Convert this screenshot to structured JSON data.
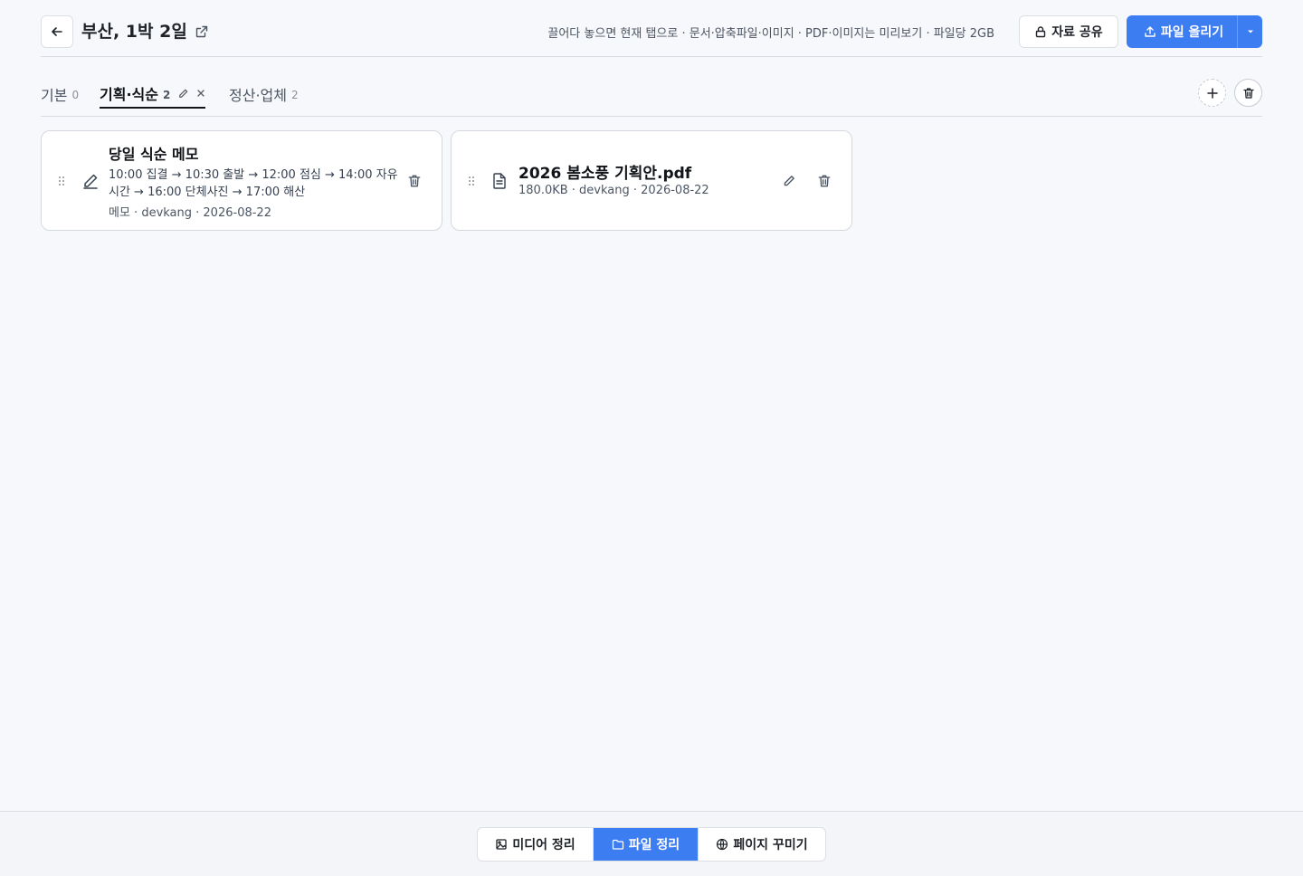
{
  "header": {
    "title": "부산, 1박 2일",
    "hint": "끌어다 놓으면 현재 탭으로 · 문서·압축파일·이미지 · PDF·이미지는 미리보기 · 파일당 2GB",
    "share_label": "자료 공유",
    "upload_label": "파일 올리기"
  },
  "tabs": [
    {
      "label": "기본",
      "count": "0"
    },
    {
      "label": "기획·식순",
      "count": "2"
    },
    {
      "label": "정산·업체",
      "count": "2"
    }
  ],
  "cards": [
    {
      "title": "당일 식순 메모",
      "body": "10:00 집결 → 10:30 출발 → 12:00 점심 → 14:00 자유시간 → 16:00 단체사진 → 17:00 해산",
      "meta": "메모 · devkang · 2026-08-22"
    },
    {
      "title": "2026 봄소풍 기획안.pdf",
      "meta": "180.0KB · devkang · 2026-08-22"
    }
  ],
  "footer": {
    "media_label": "미디어 정리",
    "files_label": "파일 정리",
    "page_label": "페이지 꾸미기"
  },
  "colors": {
    "accent": "#3d7df2",
    "background": "#f7f8fb"
  }
}
